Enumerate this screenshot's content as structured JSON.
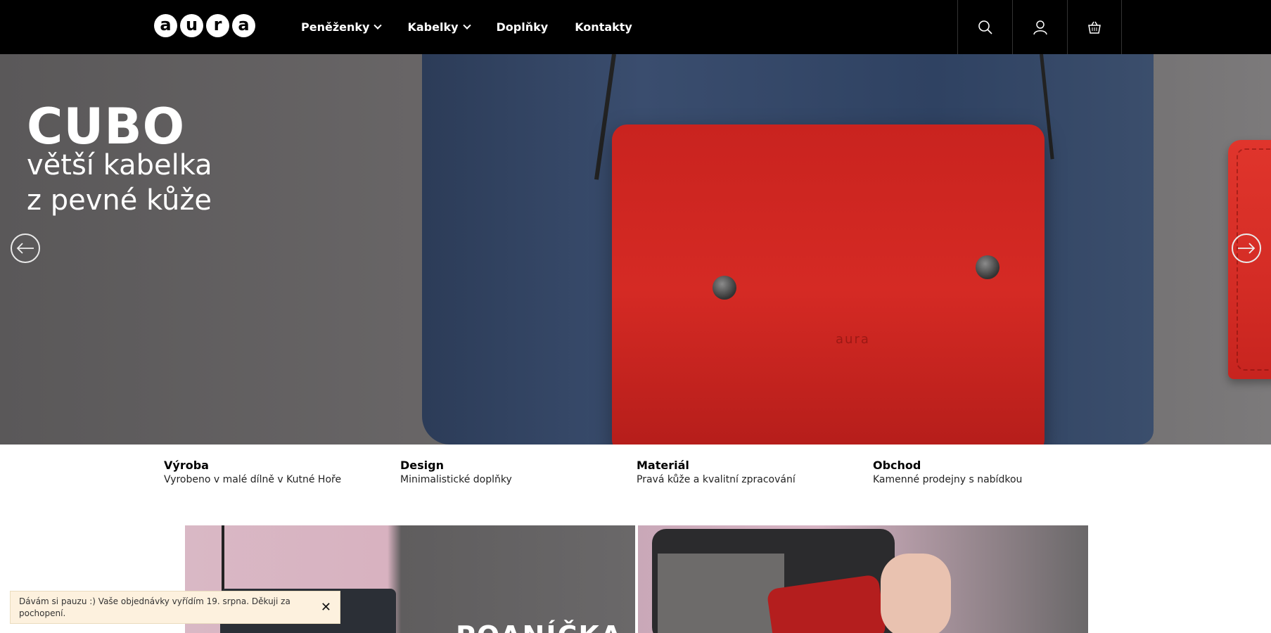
{
  "header": {
    "logo_letters": [
      "a",
      "u",
      "r",
      "a"
    ],
    "nav": [
      {
        "label": "Peněženky",
        "has_dropdown": true
      },
      {
        "label": "Kabelky",
        "has_dropdown": true
      },
      {
        "label": "Doplňky",
        "has_dropdown": false
      },
      {
        "label": "Kontakty",
        "has_dropdown": false
      }
    ],
    "icons": [
      "search-icon",
      "user-icon",
      "basket-icon"
    ]
  },
  "hero": {
    "title": "CUBO",
    "subtitle_line1": "větší kabelka",
    "subtitle_line2": "z pevné kůže",
    "bag_logo": "aura"
  },
  "features": [
    {
      "title": "Výroba",
      "text": "Vyrobeno v malé dílně v Kutné Hoře"
    },
    {
      "title": "Design",
      "text": "Minimalistické doplňky"
    },
    {
      "title": "Materiál",
      "text": "Pravá kůže a kvalitní zpracování"
    },
    {
      "title": "Obchod",
      "text": "Kamenné prodejny s nabídkou"
    }
  ],
  "tiles": {
    "tile1_text": "POANÍČKA"
  },
  "notice": {
    "text": "Dávám si pauzu :) Vaše objednávky vyřídím 19. srpna. Děkuji za pochopení.",
    "close": "✕"
  },
  "colors": {
    "header_bg": "#000000",
    "bag_red": "#d42c25",
    "notice_bg": "#fdf1de"
  }
}
